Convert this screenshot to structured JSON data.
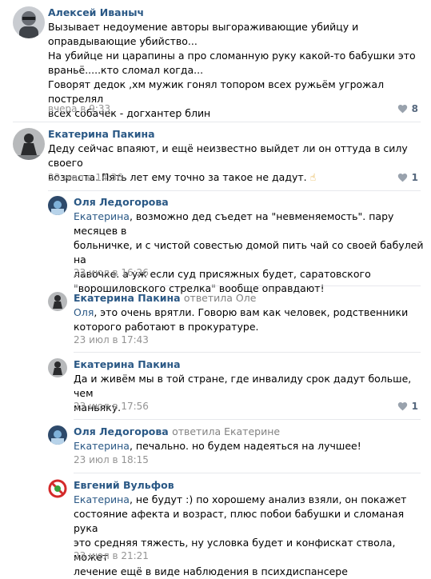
{
  "comments": [
    {
      "author": "Алексей Иваныч",
      "lines": [
        "Вызывает недоумение авторы выгораживающие убийцу и",
        "оправдывающие убийство...",
        "На убийце ни царапины а про сломанную руку какой-то бабушки это",
        "враньё.....кто сломал когда...",
        "Говорят дедок ,хм мужик гонял топором всех ружьём угрожал пострелял",
        "всех собачек - догхантер блин"
      ],
      "date": "вчера в 9:33",
      "likes": "8"
    },
    {
      "author": "Екатерина Пакина",
      "lines": [
        "Деду сейчас впаяют, и ещё неизвестно выйдет ли он оттуда в силу своего",
        "возраста. Пять лет ему точно за такое не дадут."
      ],
      "emoji": "☝",
      "date": "23 июл в 14:36",
      "likes": "1"
    },
    {
      "author": "Оля Ледогорова",
      "mention": "Екатерина",
      "lines": [
        ", возможно дед съедет на \"невменяемость\". пару месяцев в",
        "больничке, и с чистой совестью домой пить чай со своей бабулей на",
        "лавочке. а уж если суд присяжных будет, саратовского",
        "\"ворошиловского стрелка\" вообще оправдают!"
      ],
      "date": "23 июл в 16:26"
    },
    {
      "author": "Екатерина Пакина",
      "reply_label": "ответила Оле",
      "mention": "Оля",
      "lines": [
        ", это очень врятли. Говорю вам как человек, родственники",
        "которого работают в прокуратуре."
      ],
      "date": "23 июл в 17:43"
    },
    {
      "author": "Екатерина Пакина",
      "lines": [
        "Да и живём мы в той стране, где инвалиду срок дадут больше, чем",
        "маньяку."
      ],
      "date": "23 июл в 17:56",
      "likes": "1"
    },
    {
      "author": "Оля Ледогорова",
      "reply_label": "ответила Екатерине",
      "mention": "Екатерина",
      "lines": [
        ", печально. но будем надеяться на лучшее!"
      ],
      "date": "23 июл в 18:15"
    },
    {
      "author": "Евгений Вульфов",
      "mention": "Екатерина",
      "lines": [
        ", не будут :) по хорошему анализ взяли, он покажет",
        "состояние афекта и возраст, плюс побои бабушки и сломаная рука",
        "это средняя тяжесть, ну условка будет и конфискат ствола, может",
        "лечение ещё в виде наблюдения в психдиспансере"
      ],
      "date": "23 июл в 21:21"
    }
  ],
  "colors": {
    "link": "#2a5885",
    "date": "#939393",
    "separator": "#e7e8ec"
  }
}
